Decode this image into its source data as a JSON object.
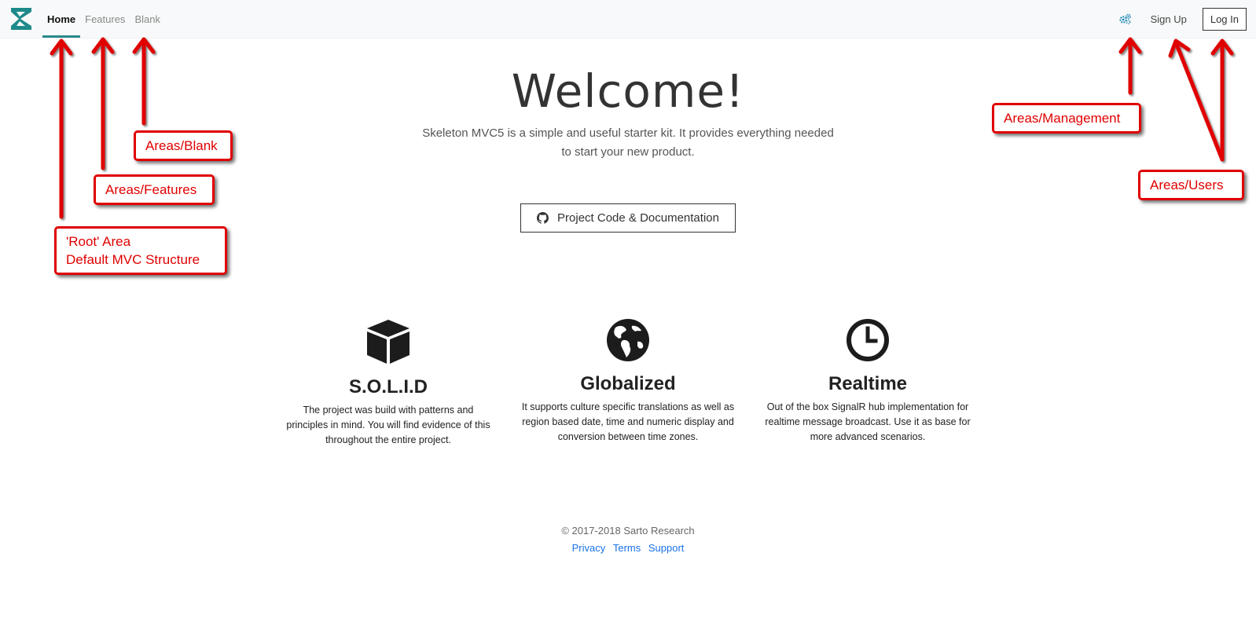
{
  "nav": {
    "brand_icon": "sarto-logo-icon",
    "links": [
      {
        "label": "Home",
        "active": true
      },
      {
        "label": "Features",
        "active": false
      },
      {
        "label": "Blank",
        "active": false
      }
    ],
    "settings_icon": "gears-icon",
    "signup_label": "Sign Up",
    "login_label": "Log In"
  },
  "hero": {
    "title": "Welcome!",
    "lead_line1": "Skeleton MVC5 is a simple and useful starter kit. It provides everything needed",
    "lead_line2": "to start your new product.",
    "button_label": "Project Code & Documentation",
    "button_icon": "github-icon"
  },
  "features": [
    {
      "icon": "cube-icon",
      "title": "S.O.L.I.D",
      "lines": [
        "The project was build with patterns and",
        "principles in mind. You will find evidence of this",
        "throughout the entire project."
      ]
    },
    {
      "icon": "globe-icon",
      "title": "Globalized",
      "lines": [
        "It supports culture specific translations as well as",
        "region based date, time and numeric display and",
        "conversion between time zones."
      ]
    },
    {
      "icon": "clock-icon",
      "title": "Realtime",
      "lines": [
        "Out of the box SignalR hub implementation for",
        "realtime message broadcast. Use it as base for",
        "more advanced scenarios."
      ]
    }
  ],
  "footer": {
    "copyright": "© 2017-2018 Sarto Research",
    "links": [
      "Privacy",
      "Terms",
      "Support"
    ]
  },
  "annotations": {
    "blank": "Areas/Blank",
    "features": "Areas/Features",
    "root_line1": "'Root' Area",
    "root_line2": "Default MVC Structure",
    "management": "Areas/Management",
    "users": "Areas/Users"
  },
  "colors": {
    "accent": "#2a8a8a",
    "annotation_red": "#e00000",
    "link_blue": "#1a73e8",
    "navbar_bg": "#f8f9fa"
  }
}
